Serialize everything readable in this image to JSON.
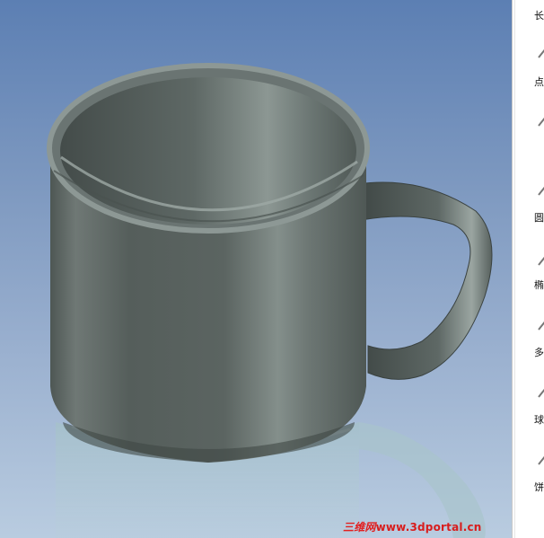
{
  "viewport": {
    "model": "mug-3d-model"
  },
  "side_panel": {
    "items": [
      {
        "label": "长",
        "icon": "rectangle-icon"
      },
      {
        "label": "点",
        "icon": "point-icon"
      },
      {
        "label": "圆",
        "icon": "circle-icon"
      },
      {
        "label": "椭",
        "icon": "ellipse-icon"
      },
      {
        "label": "多",
        "icon": "polygon-icon"
      },
      {
        "label": "球",
        "icon": "sphere-icon"
      },
      {
        "label": "饼",
        "icon": "pie-icon"
      }
    ]
  },
  "watermark": {
    "cn_text": "三维网",
    "url": "www.3dportal.cn"
  },
  "colors": {
    "watermark": "#d81d1d"
  }
}
